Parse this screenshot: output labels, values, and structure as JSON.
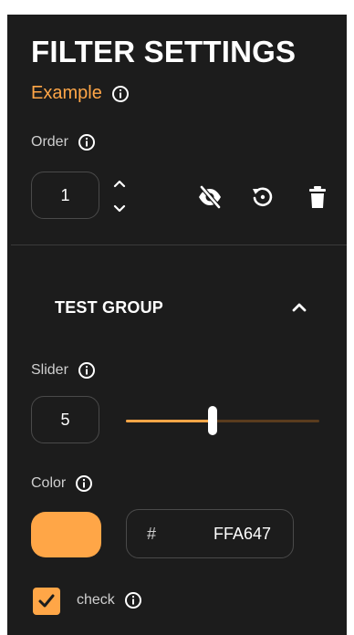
{
  "header": {
    "title": "FILTER SETTINGS",
    "subtitle": "Example"
  },
  "order": {
    "label": "Order",
    "value": "1"
  },
  "group": {
    "title": "TEST GROUP"
  },
  "slider": {
    "label": "Slider",
    "value": "5",
    "fraction": 0.45
  },
  "color": {
    "label": "Color",
    "hash": "#",
    "hex_value": "FFA647",
    "swatch": "#ffa647"
  },
  "check": {
    "label": "check",
    "checked": true
  },
  "icons": {
    "info": "info-icon",
    "stepper_up": "chevron-up-icon",
    "stepper_down": "chevron-down-icon",
    "visibility": "eye-off-icon",
    "reset": "reset-icon",
    "delete": "trash-icon",
    "collapse": "chevron-up-icon",
    "checkmark": "checkmark-icon"
  },
  "colors": {
    "accent": "#ffa647",
    "panel": "#1c1c1c"
  }
}
